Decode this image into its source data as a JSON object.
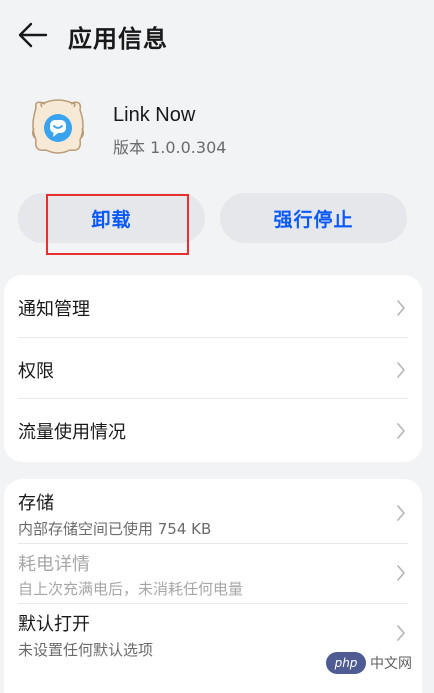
{
  "header": {
    "title": "应用信息",
    "back_icon": "back-arrow-icon"
  },
  "app": {
    "name": "Link Now",
    "version": "版本 1.0.0.304",
    "icon": "link-now-app-icon"
  },
  "actions": {
    "uninstall_label": "卸载",
    "force_stop_label": "强行停止"
  },
  "group1": {
    "items": [
      {
        "label": "通知管理"
      },
      {
        "label": "权限"
      },
      {
        "label": "流量使用情况"
      }
    ]
  },
  "group2": {
    "items": [
      {
        "label": "存储",
        "sub": "内部存储空间已使用 754 KB"
      },
      {
        "label": "耗电详情",
        "sub": "自上次充满电后，未消耗任何电量"
      },
      {
        "label": "默认打开",
        "sub": "未设置任何默认选项"
      }
    ]
  },
  "watermark": {
    "logo": "php",
    "text": "中文网"
  },
  "colors": {
    "accent": "#0a59f7",
    "background": "#f1f3f5",
    "card": "#ffffff",
    "button": "#e5e7ea",
    "highlight": "#e5302e",
    "text_primary": "#191919",
    "text_secondary": "#6b6b6b",
    "text_disabled": "#a7a7a7"
  }
}
